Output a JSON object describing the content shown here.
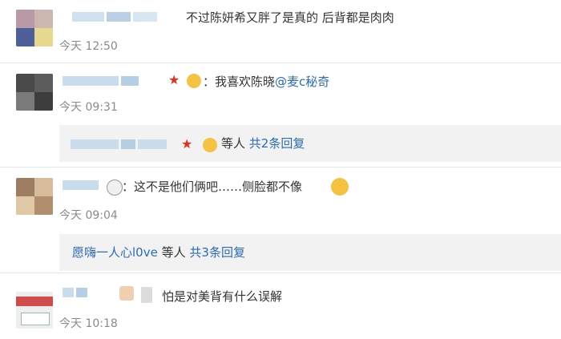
{
  "comments": [
    {
      "text": "不过陈妍希又胖了是真的 后背都是肉肉",
      "time": "今天 12:50"
    },
    {
      "text_prefix": "：我喜欢陈晓",
      "mention": "@麦c秘奇",
      "time": "今天 09:31",
      "reply": {
        "suffix": "等人",
        "count_label": "共2条回复"
      }
    },
    {
      "text": "：这不是他们俩吧……侧脸都不像",
      "time": "今天 09:04",
      "reply": {
        "user": "愿嗨一人心l0ve",
        "suffix": "等人",
        "count_label": "共3条回复"
      }
    },
    {
      "text": "怕是对美背有什么误解",
      "time": "今天 10:18"
    }
  ],
  "colors": {
    "link": "#2a6bb8",
    "reply_bg": "#f2f2f2",
    "time": "#8a8a8a",
    "emoji_yellow": "#f5c242",
    "star_red": "#e0301e"
  },
  "icons": [
    "star-badge-icon",
    "emoji-face-icon",
    "panda-emoji-icon",
    "thinking-emoji-icon"
  ]
}
